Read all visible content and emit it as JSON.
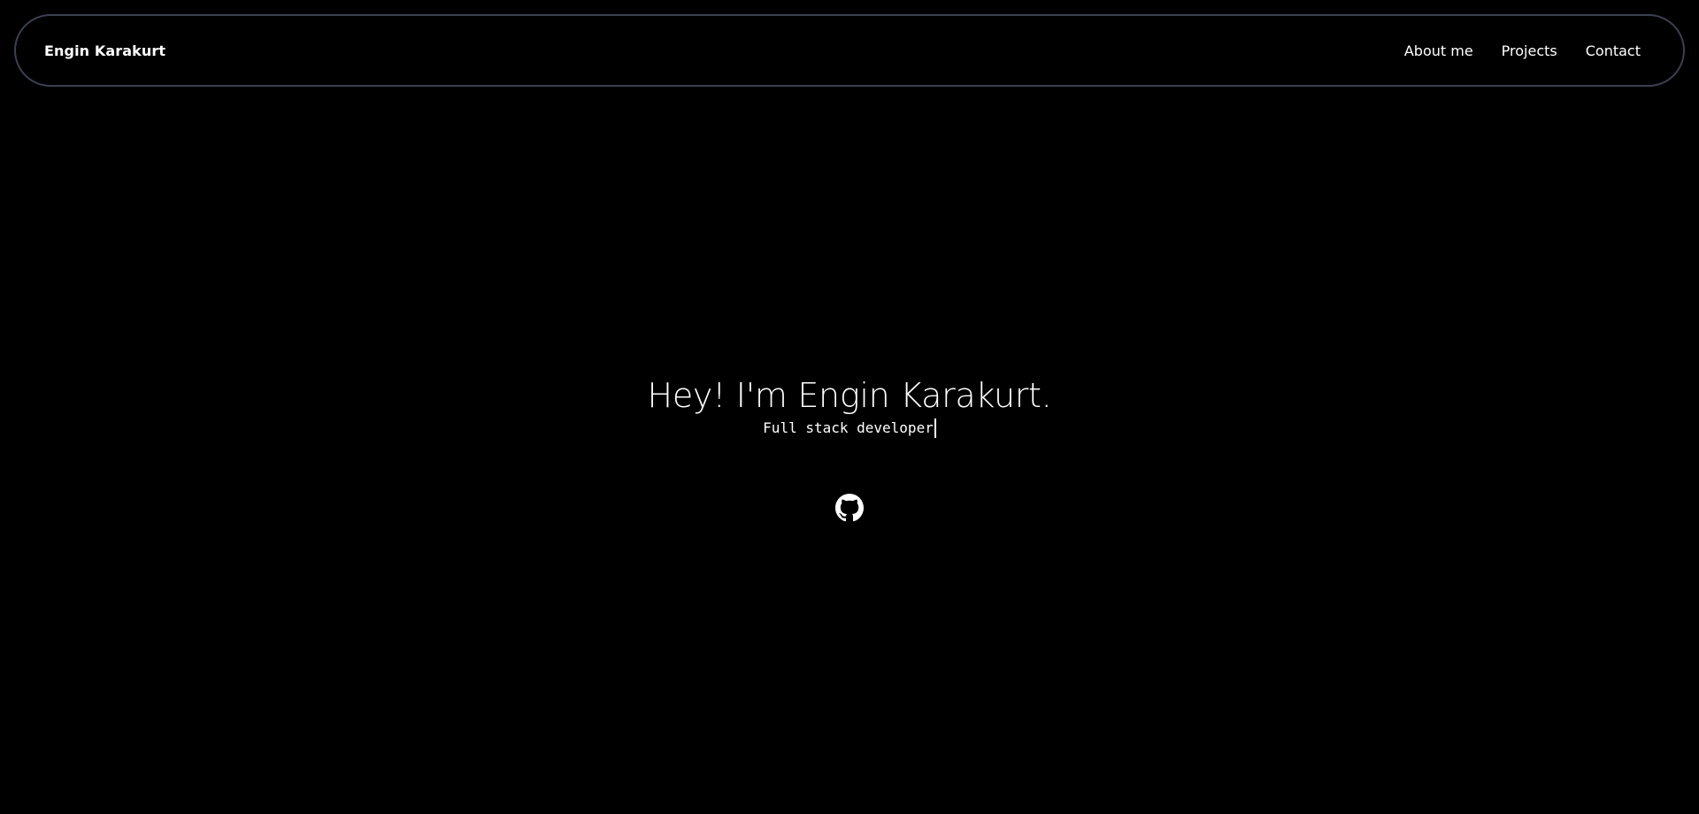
{
  "header": {
    "brand": "Engin Karakurt",
    "nav": [
      {
        "label": "About me"
      },
      {
        "label": "Projects"
      },
      {
        "label": "Contact"
      }
    ]
  },
  "hero": {
    "title": "Hey! I'm Engin Karakurt.",
    "subtitle": "Full stack developer"
  },
  "social": {
    "icon": "github-icon"
  },
  "colors": {
    "background": "#000000",
    "text": "#ffffff",
    "navbar_border": "#3a4150"
  }
}
